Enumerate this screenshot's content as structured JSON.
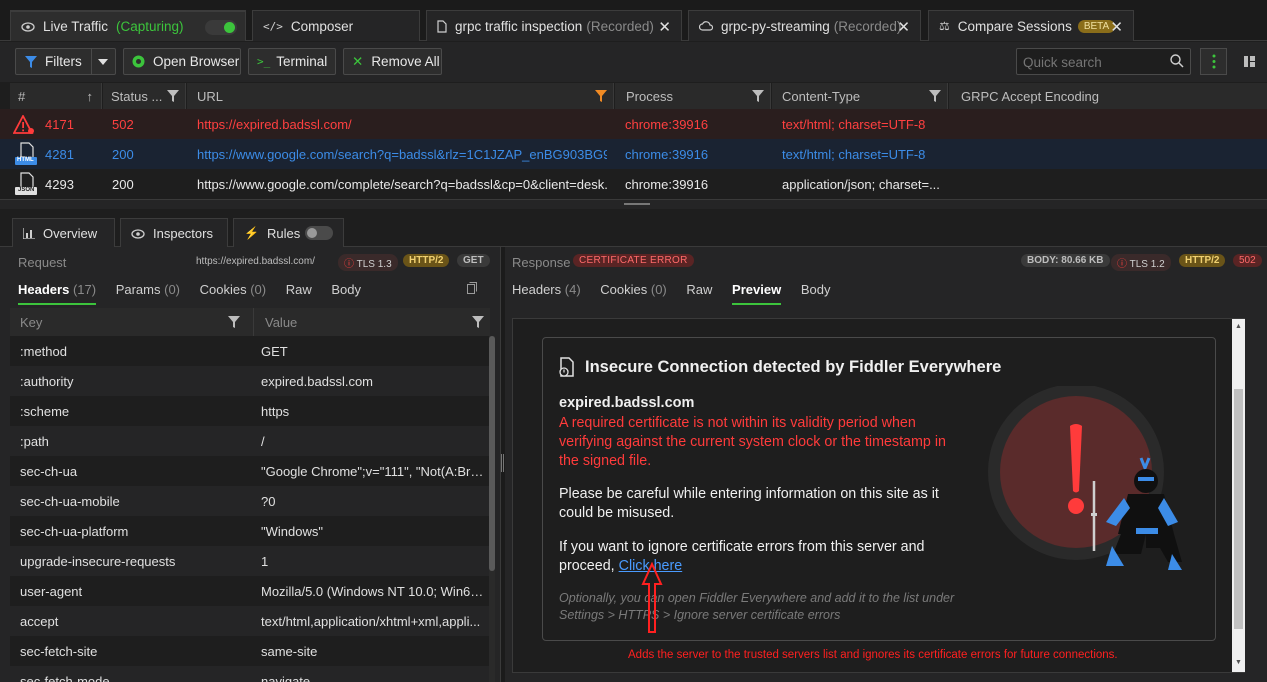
{
  "tabs": {
    "live": {
      "label": "Live Traffic",
      "status": "(Capturing)"
    },
    "composer": {
      "label": "Composer"
    },
    "grpc1": {
      "label": "grpc traffic inspection",
      "status": "(Recorded)"
    },
    "grpc2": {
      "label": "grpc-py-streaming",
      "status": "(Recorded)"
    },
    "compare": {
      "label": "Compare Sessions",
      "badge": "BETA"
    }
  },
  "toolbar": {
    "filters": "Filters",
    "open_browser": "Open Browser",
    "terminal": "Terminal",
    "remove_all": "Remove All",
    "search_placeholder": "Quick search"
  },
  "grid": {
    "columns": [
      "#",
      "Status ...",
      "URL",
      "Process",
      "Content-Type",
      "GRPC Accept Encoding"
    ],
    "rows": [
      {
        "id": "4171",
        "status": "502",
        "url": "https://expired.badssl.com/",
        "process": "chrome:39916",
        "content_type": "text/html; charset=UTF-8",
        "icon": "warning-icon",
        "color": "#ff4040"
      },
      {
        "id": "4281",
        "status": "200",
        "url": "https://www.google.com/search?q=badssl&rlz=1C1JZAP_enBG903BG90...",
        "process": "chrome:39916",
        "content_type": "text/html; charset=UTF-8",
        "icon": "html-file-icon",
        "icon_label": "HTML",
        "color": "#3c8ce7"
      },
      {
        "id": "4293",
        "status": "200",
        "url": "https://www.google.com/complete/search?q=badssl&cp=0&client=desk...",
        "process": "chrome:39916",
        "content_type": "application/json; charset=...",
        "icon": "json-file-icon",
        "icon_label": "JSON",
        "color": "#e8e8e8"
      }
    ]
  },
  "lower_tabs": {
    "overview": "Overview",
    "inspectors": "Inspectors",
    "rules": "Rules"
  },
  "request": {
    "title": "Request",
    "url": "https://expired.badssl.com/",
    "tls": "TLS 1.3",
    "http": "HTTP/2",
    "method": "GET",
    "tabs": {
      "headers": "Headers",
      "headers_count": "(17)",
      "params": "Params",
      "params_count": "(0)",
      "cookies": "Cookies",
      "cookies_count": "(0)",
      "raw": "Raw",
      "body": "Body"
    },
    "col_key": "Key",
    "col_value": "Value",
    "headers": [
      {
        "key": ":method",
        "value": "GET"
      },
      {
        "key": ":authority",
        "value": "expired.badssl.com"
      },
      {
        "key": ":scheme",
        "value": "https"
      },
      {
        "key": ":path",
        "value": "/"
      },
      {
        "key": "sec-ch-ua",
        "value": "\"Google Chrome\";v=\"111\", \"Not(A:Bra..."
      },
      {
        "key": "sec-ch-ua-mobile",
        "value": "?0"
      },
      {
        "key": "sec-ch-ua-platform",
        "value": "\"Windows\""
      },
      {
        "key": "upgrade-insecure-requests",
        "value": "1"
      },
      {
        "key": "user-agent",
        "value": "Mozilla/5.0 (Windows NT 10.0; Win64; ..."
      },
      {
        "key": "accept",
        "value": "text/html,application/xhtml+xml,appli..."
      },
      {
        "key": "sec-fetch-site",
        "value": "same-site"
      },
      {
        "key": "sec-fetch-mode",
        "value": "navigate"
      }
    ]
  },
  "response": {
    "title": "Response",
    "badge": "CERTIFICATE ERROR",
    "body_size": "BODY: 80.66 KB",
    "tls": "TLS 1.2",
    "http": "HTTP/2",
    "status": "502",
    "tabs": {
      "headers": "Headers",
      "headers_count": "(4)",
      "cookies": "Cookies",
      "cookies_count": "(0)",
      "raw": "Raw",
      "preview": "Preview",
      "body": "Body"
    }
  },
  "preview": {
    "heading": "Insecure Connection detected by Fiddler Everywhere",
    "host": "expired.badssl.com",
    "error_line1": "A required certificate is not within its validity period when",
    "error_line2": "verifying against the current system clock or the timestamp in",
    "error_line3": "the signed file.",
    "careful_line1": "Please be careful while entering information on this site as it",
    "careful_line2": "could be misused.",
    "ignore_line1": "If you want to ignore certificate errors from this server and",
    "ignore_prefix": "proceed, ",
    "click_here": "Click here",
    "optional_line1": "Optionally, you can open Fiddler Everywhere and add it to the list under",
    "optional_line2": "Settings > HTTPS > Ignore server certificate errors"
  },
  "annotation": "Adds the server to the trusted servers list and ignores its certificate errors  for future connections.",
  "colors": {
    "accent_green": "#3cc43c",
    "error_red": "#ff3b3b",
    "link_blue": "#4a9bff",
    "http_badge": "#d8b040"
  }
}
